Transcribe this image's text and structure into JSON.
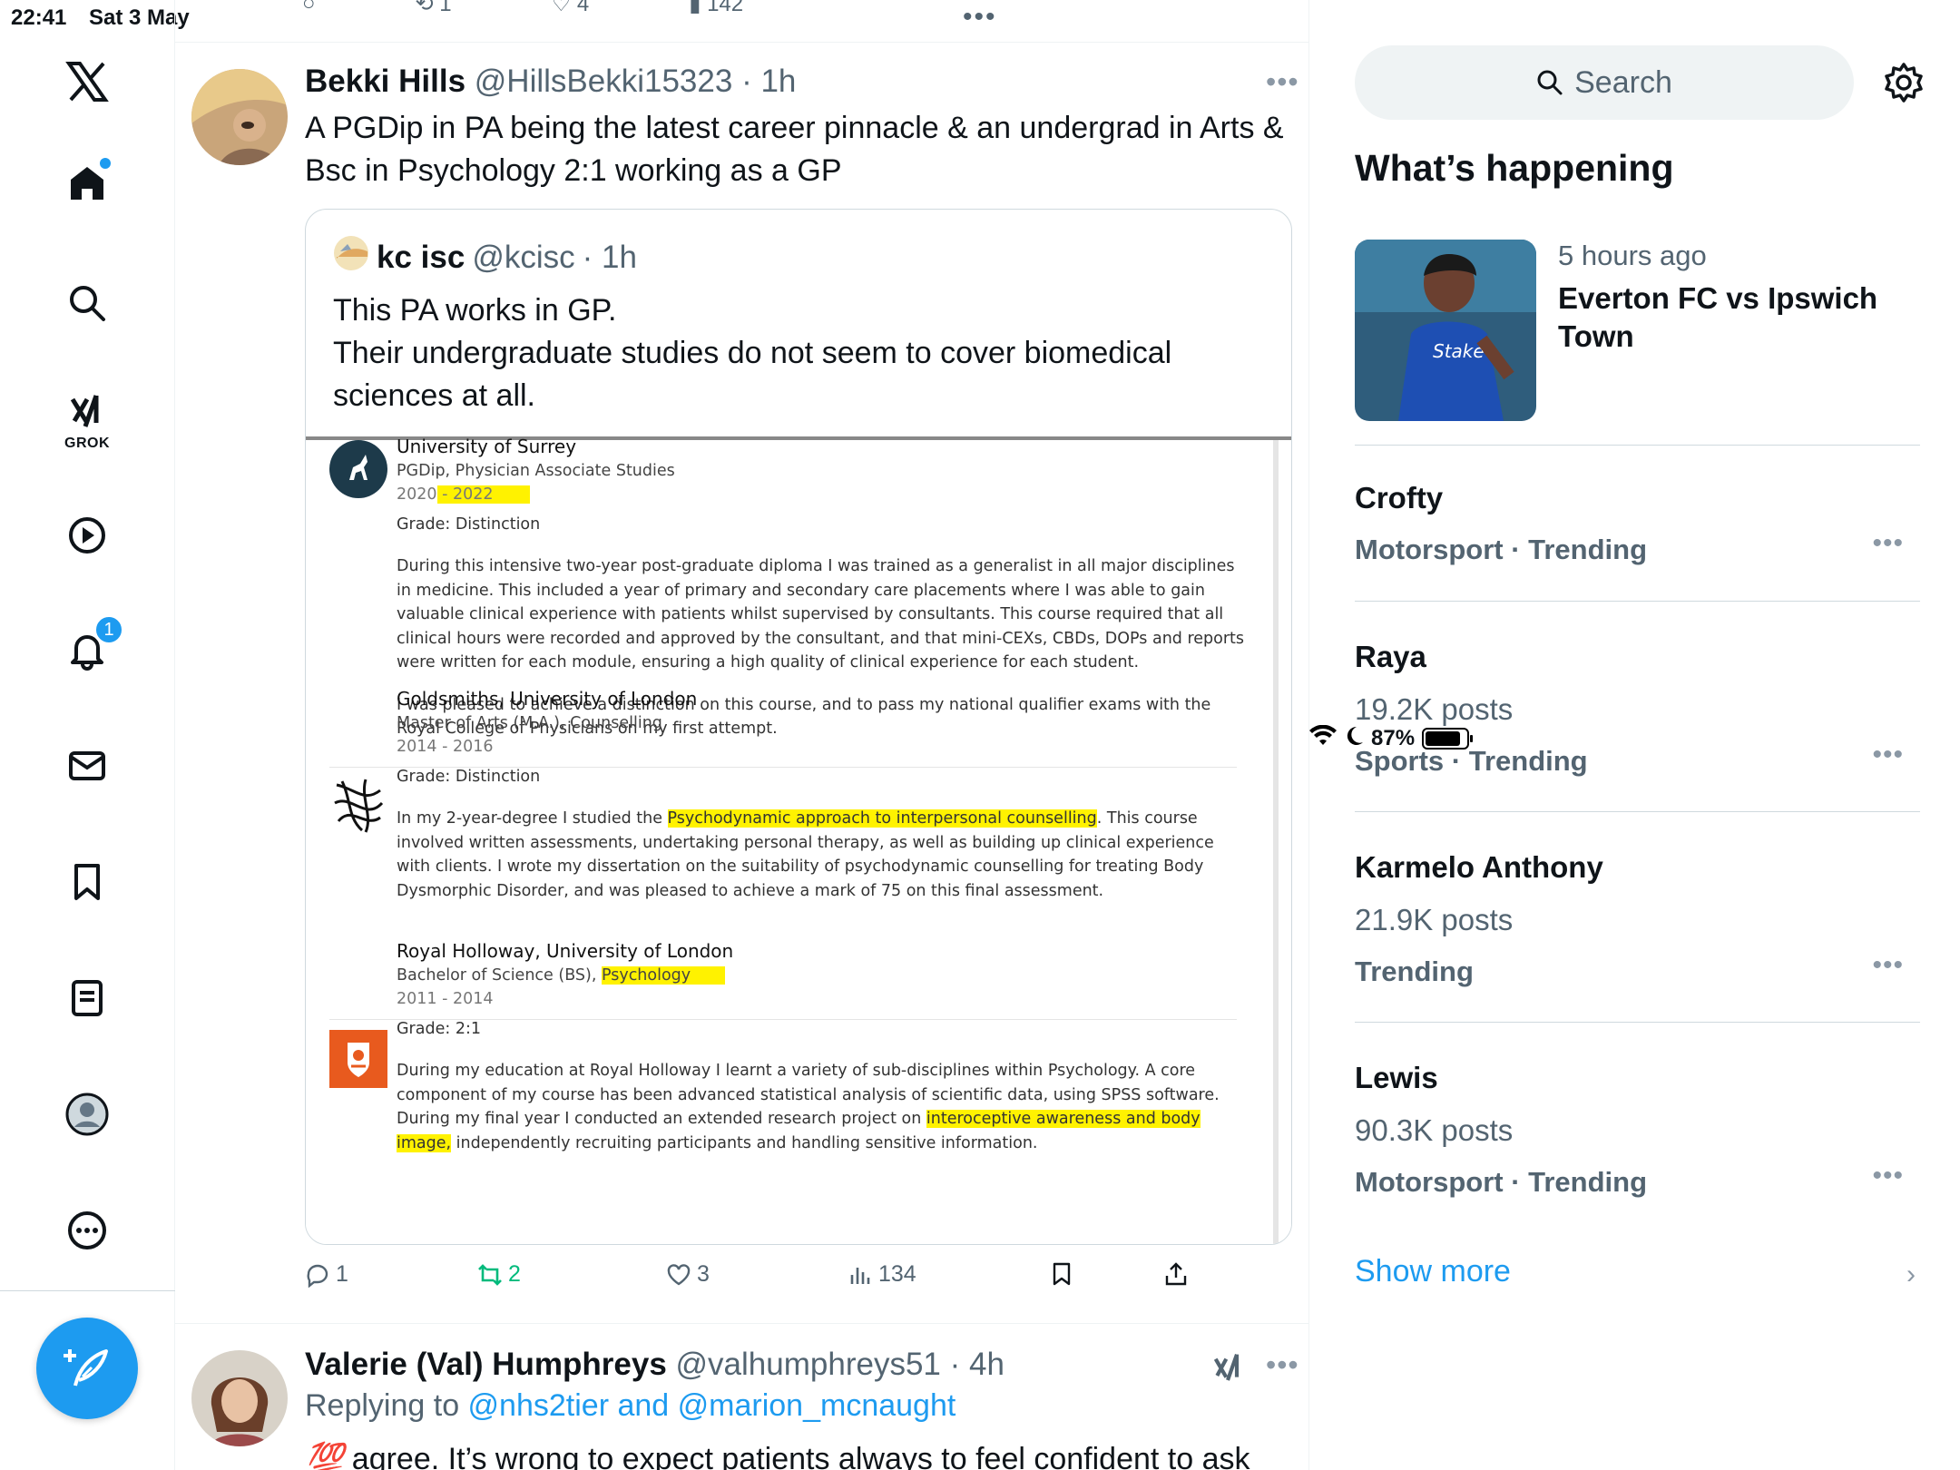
{
  "status": {
    "time": "22:41",
    "date": "Sat 3 May",
    "battery": "87%",
    "battery_level": 0.87
  },
  "nav": {
    "grok_label": "GROK",
    "notifications_badge": "1",
    "icons": [
      "x-logo-icon",
      "home-icon",
      "search-icon",
      "grok-icon",
      "video-icon",
      "notifications-icon",
      "messages-icon",
      "bookmarks-icon",
      "lists-icon",
      "profile-icon",
      "more-icon",
      "compose-icon"
    ]
  },
  "prev_tweet_actions": {
    "retweets": "1",
    "likes": "4",
    "views": "142"
  },
  "tweet": {
    "name": "Bekki Hills",
    "handle": "@HillsBekki15323",
    "time": "· 1h",
    "text": "A PGDip in PA being the latest career pinnacle & an undergrad in Arts & Bsc in Psychology 2:1 working as a GP",
    "quote": {
      "name": "kc isc",
      "handle": "@kcisc",
      "time": "· 1h",
      "text_line1": "This PA works in GP.",
      "text_line2": "Their undergraduate studies do not seem to cover biomedical sciences at all.",
      "education": [
        {
          "school": "University of Surrey",
          "degree": "PGDip, Physician Associate Studies",
          "years_start": "2020",
          "years_end": " - 2022",
          "grade": "Grade: Distinction",
          "para1": "During this intensive two-year post-graduate diploma I was trained as a generalist in all major disciplines in medicine. This included a year of primary and secondary care placements where I was able to gain valuable clinical experience with patients whilst supervised by consultants. This course required that all clinical hours were recorded and approved by the consultant, and that mini-CEXs, CBDs, DOPs and reports were written for each module, ensuring a high quality of clinical experience for each student.",
          "para2": "I was pleased to achieve a distinction on this course, and to pass my national qualifier exams with the Royal College of Physicians on my first attempt."
        },
        {
          "school": "Goldsmiths, University of London",
          "degree": "Master of Arts (M.A.), Counselling",
          "years": "2014 - 2016",
          "grade": "Grade: Distinction",
          "para_pre": "In my 2-year-degree I studied the ",
          "para_hl": "Psychodynamic approach to interpersonal counselling",
          "para_post": ". This course involved written assessments, undertaking personal therapy, as well as building up clinical experience with clients. I wrote my dissertation on the suitability of psychodynamic counselling for treating Body Dysmorphic Disorder, and was pleased to achieve a mark of 75 on this final assessment."
        },
        {
          "school": "Royal Holloway, University of London",
          "degree_pre": "Bachelor of Science (BS), ",
          "degree_hl": "Psychology",
          "years": "2011 - 2014",
          "grade": "Grade: 2:1",
          "para_pre": "During my education at Royal Holloway I learnt a variety of sub-disciplines within Psychology. A core component of my course has been advanced statistical analysis of scientific data, using SPSS software. During my final year I conducted an extended research project on ",
          "para_hl": "interoceptive awareness and body image,",
          "para_post": " independently recruiting participants and handling sensitive information."
        }
      ]
    },
    "replies": "1",
    "retweets": "2",
    "likes": "3",
    "views": "134"
  },
  "tweet2": {
    "name": "Valerie (Val) Humphreys",
    "handle": "@valhumphreys51",
    "time": "· 4h",
    "replying_label": "Replying to ",
    "replying_to": "@nhs2tier and @marion_mcnaught",
    "emoji": "💯",
    "text": " agree. It’s wrong to expect patients always to feel confident to ask"
  },
  "sidebar": {
    "search_placeholder": "Search",
    "title": "What’s happening",
    "event": {
      "time": "5 hours ago",
      "title": "Everton FC vs Ipswich Town",
      "shirt_text": "Stake"
    },
    "trends": [
      {
        "name": "Crofty",
        "posts": "",
        "category": "Motorsport · Trending"
      },
      {
        "name": "Raya",
        "posts": "19.2K posts",
        "category": "Sports · Trending"
      },
      {
        "name": "Karmelo Anthony",
        "posts": "21.9K posts",
        "category": "Trending"
      },
      {
        "name": "Lewis",
        "posts": "90.3K posts",
        "category": "Motorsport · Trending"
      }
    ],
    "show_more": "Show more"
  },
  "colors": {
    "accent": "#1d9bf0",
    "retweet": "#00ba7c",
    "muted": "#536471",
    "highlight": "#fff200"
  }
}
